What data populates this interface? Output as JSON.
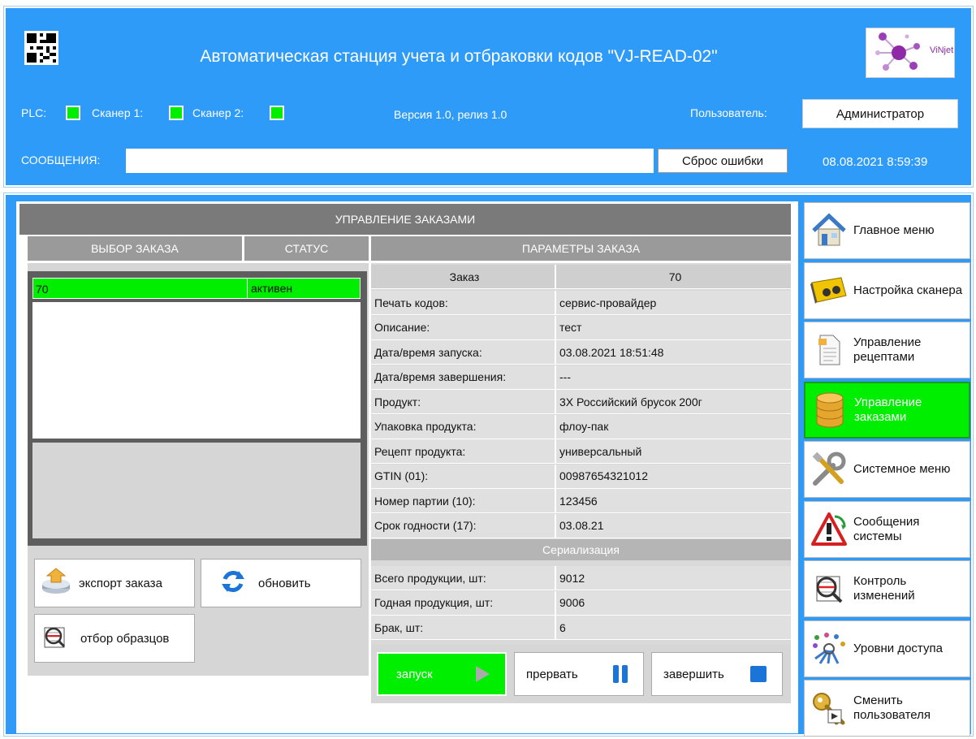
{
  "header": {
    "title": "Автоматическая станция учета и отбраковки кодов \"VJ-READ-02\"",
    "logo_text": "ViNjet",
    "plc_label": "PLC:",
    "scanner1_label": "Сканер 1:",
    "scanner2_label": "Сканер 2:",
    "version": "Версия 1.0, релиз 1.0",
    "user_label": "Пользователь:",
    "user_value": "Администратор",
    "messages_label": "СООБЩЕНИЯ:",
    "messages_value": "",
    "reset_label": "Сброс ошибки",
    "datetime": "08.08.2021 8:59:39",
    "status_color": "#00ee00"
  },
  "orders": {
    "title": "УПРАВЛЕНИЕ ЗАКАЗАМИ",
    "col_select": "ВЫБОР ЗАКАЗА",
    "col_status": "СТАТУС",
    "params_title": "ПАРАМЕТРЫ ЗАКАЗА",
    "list": [
      {
        "order": "70",
        "status": "активен"
      }
    ],
    "buttons": {
      "export": "экспорт заказа",
      "refresh": "обновить",
      "sample": "отбор образцов"
    }
  },
  "params": {
    "head_label": "Заказ",
    "head_value": "70",
    "rows": [
      {
        "label": "Печать кодов:",
        "value": "сервис-провайдер"
      },
      {
        "label": "Описание:",
        "value": "тест"
      },
      {
        "label": "Дата/время запуска:",
        "value": "03.08.2021 18:51:48"
      },
      {
        "label": "Дата/время завершения:",
        "value": "---"
      },
      {
        "label": "Продукт:",
        "value": "3X Российский брусок 200г"
      },
      {
        "label": "Упаковка продукта:",
        "value": "флоу-пак"
      },
      {
        "label": "Рецепт продукта:",
        "value": "универсальный"
      },
      {
        "label": "GTIN (01):",
        "value": "00987654321012"
      },
      {
        "label": "Номер партии (10):",
        "value": "123456"
      },
      {
        "label": "Срок годности (17):",
        "value": "03.08.21"
      }
    ],
    "serial_title": "Сериализация",
    "serial_rows": [
      {
        "label": "Всего продукции, шт:",
        "value": "9012"
      },
      {
        "label": "Годная продукция, шт:",
        "value": "9006"
      },
      {
        "label": "Брак, шт:",
        "value": "6"
      }
    ]
  },
  "controls": {
    "start": "запуск",
    "pause": "прервать",
    "finish": "завершить"
  },
  "nav": [
    {
      "label": "Главное меню",
      "icon": "house-icon"
    },
    {
      "label": "Настройка сканера",
      "icon": "scanner-icon"
    },
    {
      "label": "Управление рецептами",
      "icon": "document-icon"
    },
    {
      "label": "Управление заказами",
      "icon": "database-icon",
      "active": true
    },
    {
      "label": "Системное меню",
      "icon": "tools-icon"
    },
    {
      "label": "Сообщения системы",
      "icon": "warning-icon"
    },
    {
      "label": "Контроль изменений",
      "icon": "magnifier-icon"
    },
    {
      "label": "Уровни доступа",
      "icon": "users-keys-icon"
    },
    {
      "label": "Сменить пользователя",
      "icon": "key-icon"
    }
  ]
}
